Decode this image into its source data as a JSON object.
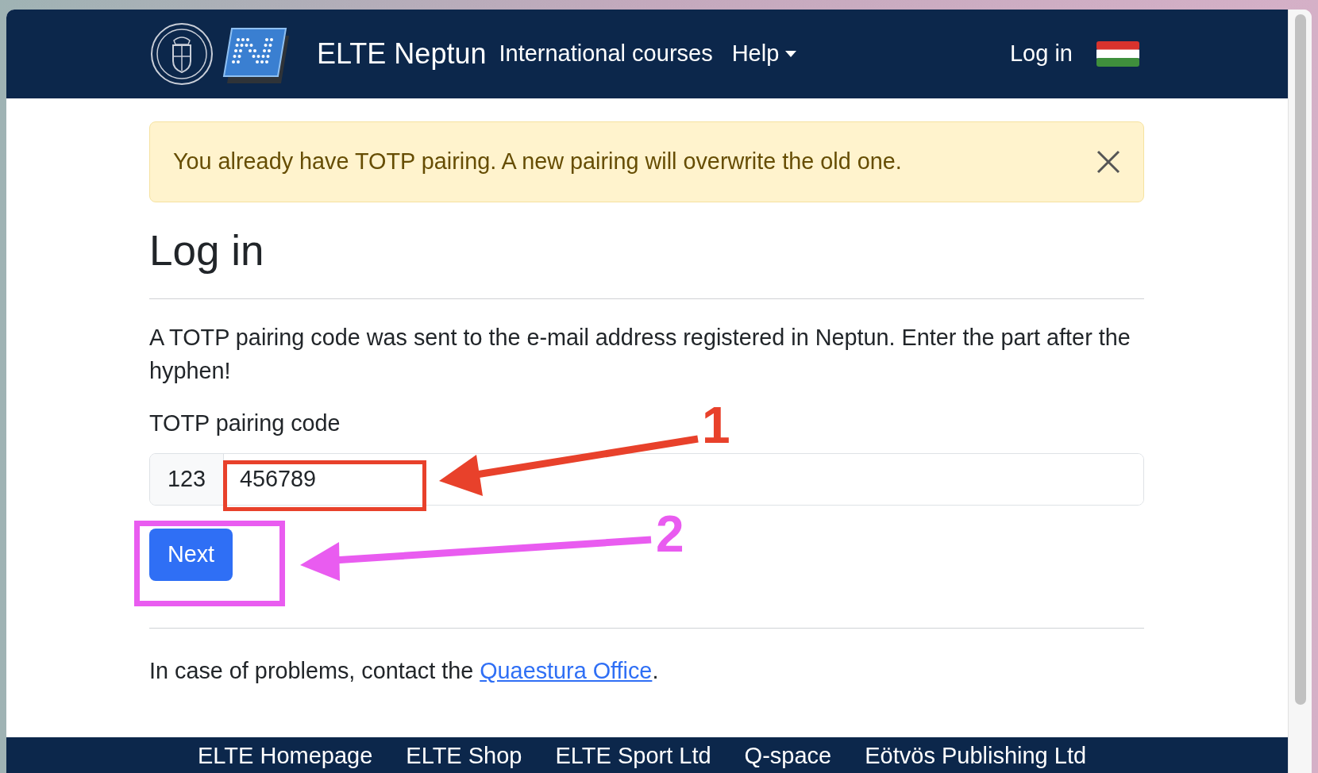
{
  "nav": {
    "brand": "ELTE Neptun",
    "links": [
      {
        "label": "International courses",
        "dropdown": false
      },
      {
        "label": "Help",
        "dropdown": true
      }
    ],
    "login": "Log in"
  },
  "alert": {
    "message": "You already have TOTP pairing. A new pairing will overwrite the old one.",
    "dismissible": true
  },
  "heading": "Log in",
  "instructions": "A TOTP pairing code was sent to the e-mail address registered in Neptun. Enter the part after the hyphen!",
  "field": {
    "label": "TOTP pairing code",
    "prefix": "123",
    "value": "456789"
  },
  "button": "Next",
  "help": {
    "text": "In case of problems, contact the",
    "link": "Quaestura Office",
    "after": "."
  },
  "annotations": [
    {
      "number": "1",
      "color": "#e8412b"
    },
    {
      "number": "2",
      "color": "#e95cf0"
    }
  ],
  "footer": {
    "links": [
      "ELTE Homepage",
      "ELTE Shop",
      "ELTE Sport Ltd",
      "Q-space",
      "Eötvös Publishing Ltd"
    ]
  }
}
